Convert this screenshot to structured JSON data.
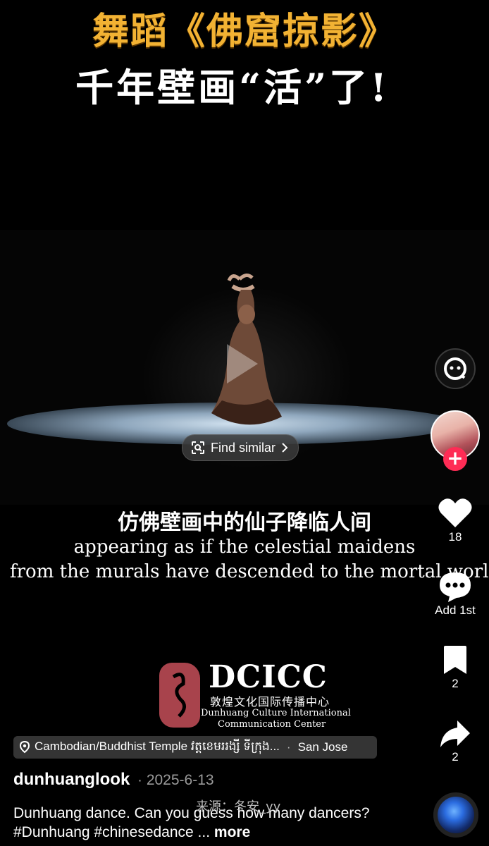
{
  "headline": {
    "line1": "舞蹈《佛窟掠影》",
    "line2": "千年壁画“活”了!"
  },
  "video": {
    "find_similar_label": "Find similar"
  },
  "subtitles": {
    "chinese": "仿佛壁画中的仙子降临人间",
    "english_line1": "appearing as if the celestial maidens",
    "english_line2": "from the murals have descended to the mortal world,"
  },
  "logo": {
    "title": "DCICC",
    "chinese_name": "敦煌文化国际传播中心",
    "english_line1": "Dunhuang Culture International",
    "english_line2": "Communication Center"
  },
  "location": {
    "place": "Cambodian/Buddhist Temple វត្តខេមររង្សី ទីក្រុង...",
    "separator": "·",
    "city": "San Jose"
  },
  "post": {
    "username": "dunhuanglook",
    "date": "· 2025-6-13",
    "source_watermark": "来源：冬安_yy",
    "description": "Dunhuang dance. Can you guess how many dancers?#Dunhuang #chinesedance ...",
    "more_label": "more"
  },
  "rail": {
    "likes": "18",
    "comments": "Add 1st",
    "saves": "2",
    "shares": "2"
  },
  "colors": {
    "headline_gold": "#f2b233",
    "follow_red": "#fe2c55",
    "logo_seal_red": "#a8434c"
  },
  "icons": [
    "search-face-icon",
    "heart-icon",
    "comment-icon",
    "bookmark-icon",
    "share-icon",
    "location-pin-icon",
    "scan-icon",
    "chevron-right-icon",
    "play-icon",
    "plus-icon"
  ]
}
